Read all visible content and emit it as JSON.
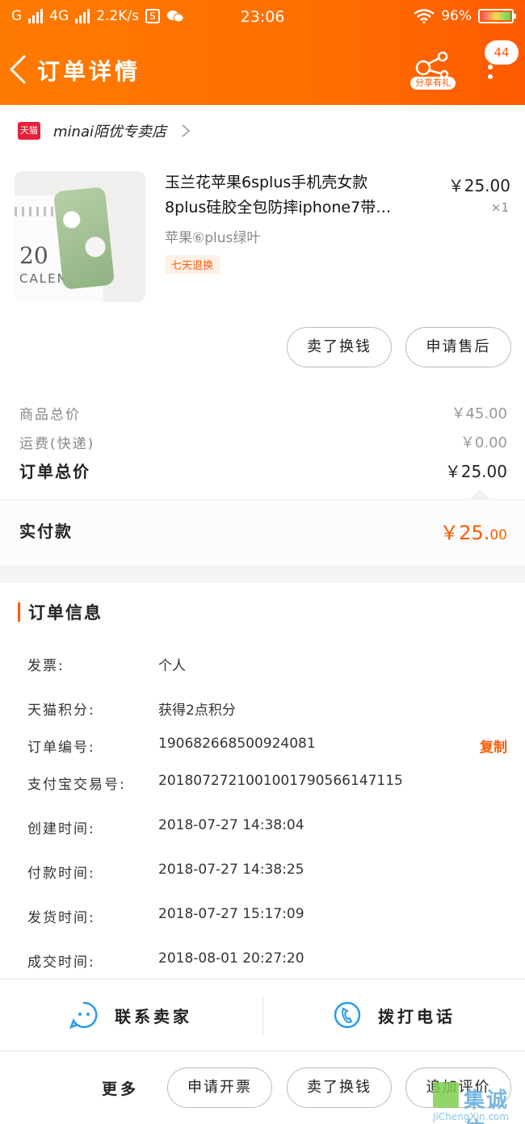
{
  "status_bar": {
    "carrier1": "G",
    "carrier2": "4G",
    "speed": "2.2K/s",
    "time": "23:06",
    "battery": "96%"
  },
  "nav": {
    "title": "订单详情",
    "share_label": "分享有礼",
    "badge_count": "44"
  },
  "shop": {
    "logo_text": "天猫",
    "name": "minai陌优专卖店"
  },
  "product": {
    "title_line1": "玉兰花苹果6splus手机壳女款",
    "title_line2": "8plus硅胶全包防摔iphone7带…",
    "price": "￥25.00",
    "quantity": "×1",
    "sku": "苹果⑥plus绿叶",
    "tag": "七天退换",
    "image_text1": "20",
    "image_text2": "CALEN"
  },
  "actions": {
    "sell_exchange": "卖了换钱",
    "after_sale": "申请售后"
  },
  "summary": {
    "goods_total_label": "商品总价",
    "goods_total_value": "￥45.00",
    "shipping_label": "运费(快递)",
    "shipping_value": "￥0.00",
    "order_total_label": "订单总价",
    "order_total_value": "￥25.00",
    "paid_label": "实付款",
    "paid_value_main": "￥25.",
    "paid_value_decimal": "00"
  },
  "order_info": {
    "heading": "订单信息",
    "rows": [
      {
        "key": "发票:",
        "value": "个人"
      },
      {
        "key": "天猫积分:",
        "value": "获得2点积分"
      },
      {
        "key": "订单编号:",
        "value": "190682668500924081"
      },
      {
        "key": "支付宝交易号:",
        "value": "2018072721001001790566147115"
      },
      {
        "key": "创建时间:",
        "value": "2018-07-27 14:38:04"
      },
      {
        "key": "付款时间:",
        "value": "2018-07-27 14:38:25"
      },
      {
        "key": "发货时间:",
        "value": "2018-07-27 15:17:09"
      },
      {
        "key": "成交时间:",
        "value": "2018-08-01 20:27:20"
      }
    ],
    "copy_label": "复制"
  },
  "bottom": {
    "contact_seller": "联系卖家",
    "call_phone": "拨打电话",
    "more": "更多",
    "invoice": "申请开票",
    "sell_exchange": "卖了换钱",
    "add_review": "追加评价"
  },
  "watermark": {
    "text": "集诚信",
    "sub": "JiChengXin.com"
  },
  "colors": {
    "accent": "#ff5a00",
    "header_start": "#ff7a00",
    "tmall_red": "#e8203a",
    "icon_blue": "#2a9be8"
  }
}
